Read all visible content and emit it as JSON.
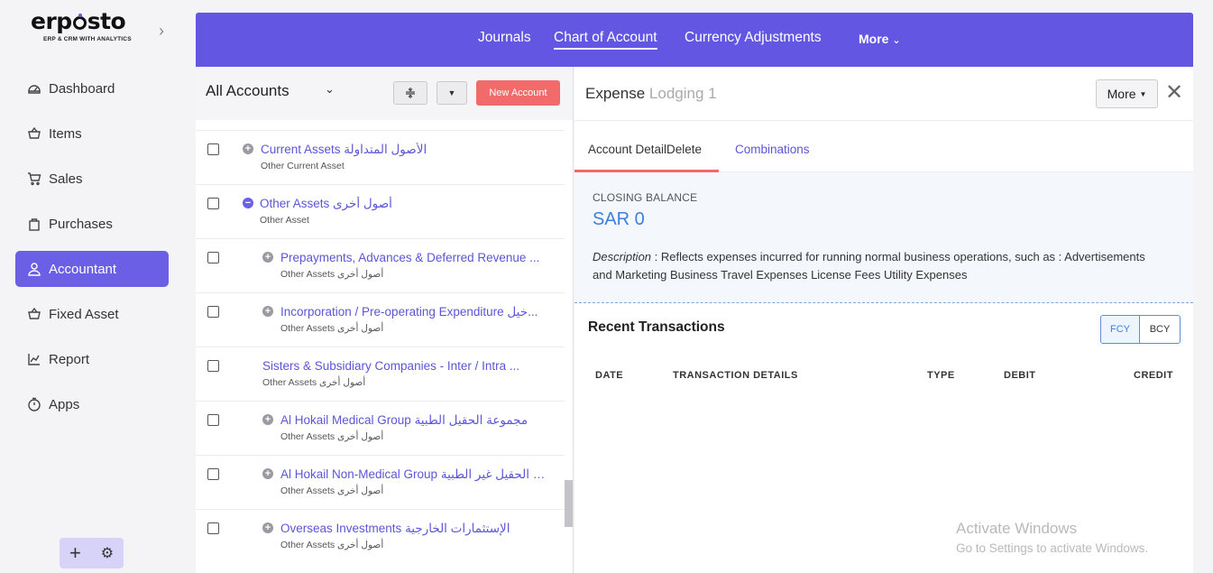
{
  "brand": {
    "logo_main": "erpsto",
    "logo_sub": "ERP & CRM WITH ANALYTICS"
  },
  "sidebar": {
    "items": [
      {
        "label": "Dashboard",
        "icon": "dashboard-icon",
        "active": false
      },
      {
        "label": "Items",
        "icon": "basket-icon",
        "active": false
      },
      {
        "label": "Sales",
        "icon": "cart-icon",
        "active": false
      },
      {
        "label": "Purchases",
        "icon": "bag-icon",
        "active": false
      },
      {
        "label": "Accountant",
        "icon": "user-icon",
        "active": true
      },
      {
        "label": "Fixed Asset",
        "icon": "basket-icon",
        "active": false
      },
      {
        "label": "Report",
        "icon": "chart-icon",
        "active": false
      },
      {
        "label": "Apps",
        "icon": "clock-icon",
        "active": false
      }
    ]
  },
  "topnav": {
    "tabs": [
      {
        "label": "Journals"
      },
      {
        "label": "Chart of Account",
        "active": true
      },
      {
        "label": "Currency Adjustments"
      }
    ],
    "more_label": "More"
  },
  "list": {
    "title": "All Accounts",
    "new_button": "New Account",
    "rows": [
      {
        "name": "Current Assets الأصول المتداولة",
        "sub": "Other Current Asset",
        "toggle": "plus"
      },
      {
        "name": "Other Assets أصول أخرى",
        "sub": "Other Asset",
        "toggle": "minus"
      },
      {
        "name": "Prepayments, Advances & Deferred Revenue ...",
        "sub": "Other Assets أصول أخرى",
        "toggle": "plus"
      },
      {
        "name": "Incorporation / Pre-operating Expenditure خيل...",
        "sub": "Other Assets أصول أخرى",
        "toggle": "plus"
      },
      {
        "name": "Sisters & Subsidiary Companies - Inter / Intra ...",
        "sub": "Other Assets أصول أخرى",
        "toggle": "none"
      },
      {
        "name": "Al Hokail Medical Group مجموعة الحقيل الطبية",
        "sub": "Other Assets أصول أخرى",
        "toggle": "plus"
      },
      {
        "name": "Al Hokail Non-Medical Group عة الحقيل غير الطبية...",
        "sub": "Other Assets أصول أخرى",
        "toggle": "plus"
      },
      {
        "name": "Overseas Investments الإستثمارات الخارجية",
        "sub": "Other Assets أصول أخرى",
        "toggle": "plus"
      }
    ]
  },
  "detail": {
    "title_type": "Expense",
    "title_name": "Lodging 1",
    "more_button": "More",
    "tabs": {
      "active": "Account DetailDelete",
      "other": "Combinations"
    },
    "closing_label": "CLOSING BALANCE",
    "closing_value": "SAR 0",
    "description_label": "Description",
    "description_text": " : Reflects expenses incurred for running normal business operations, such as : Advertisements and Marketing Business Travel Expenses License Fees Utility Expenses",
    "recent_title": "Recent Transactions",
    "toggle": {
      "fcy": "FCY",
      "bcy": "BCY"
    },
    "columns": {
      "date": "DATE",
      "details": "TRANSACTION DETAILS",
      "type": "TYPE",
      "debit": "DEBIT",
      "credit": "CREDIT"
    }
  },
  "watermark": {
    "line1": "Activate Windows",
    "line2": "Go to Settings to activate Windows."
  },
  "colors": {
    "accent": "#6356e2",
    "danger": "#f26b6b",
    "link": "#5b56d6",
    "balance": "#3f7fd8"
  }
}
